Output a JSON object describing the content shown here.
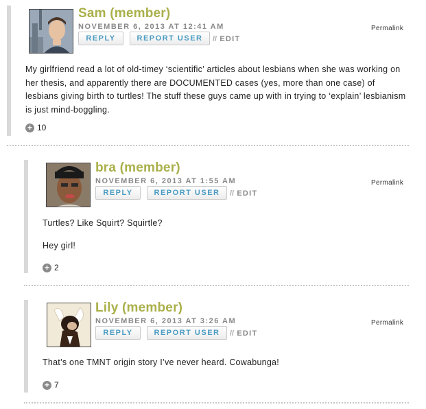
{
  "comments": [
    {
      "author": "Sam (member)",
      "date": "NOVEMBER 6, 2013 AT 12:41 AM",
      "reply": "REPLY",
      "report": "REPORT USER",
      "edit_sep": "//",
      "edit": "EDIT",
      "permalink": "Permalink",
      "body": [
        "My girlfriend read a lot of old-timey ‘scientific’ articles about lesbians when she was working on her thesis, and apparently there are DOCUMENTED cases (yes, more than one case) of lesbians giving birth to turtles! The stuff these guys came up with in trying to ‘explain’ lesbianism is just mind-boggling."
      ],
      "votes": "10"
    },
    {
      "author": "bra (member)",
      "date": "NOVEMBER 6, 2013 AT 1:55 AM",
      "reply": "REPLY",
      "report": "REPORT USER",
      "edit_sep": "//",
      "edit": "EDIT",
      "permalink": "Permalink",
      "body": [
        "Turtles? Like Squirt? Squirtle?",
        "Hey girl!"
      ],
      "votes": "2"
    },
    {
      "author": "Lily (member)",
      "date": "NOVEMBER 6, 2013 AT 3:26 AM",
      "reply": "REPLY",
      "report": "REPORT USER",
      "edit_sep": "//",
      "edit": "EDIT",
      "permalink": "Permalink",
      "body": [
        "That’s one TMNT origin story I’ve never heard. Cowabunga!"
      ],
      "votes": "7"
    }
  ],
  "icons": {
    "vote": "plus-circle-icon"
  },
  "colors": {
    "author": "#aab04a",
    "button_text": "#4a9bc2",
    "meta": "#888888"
  }
}
